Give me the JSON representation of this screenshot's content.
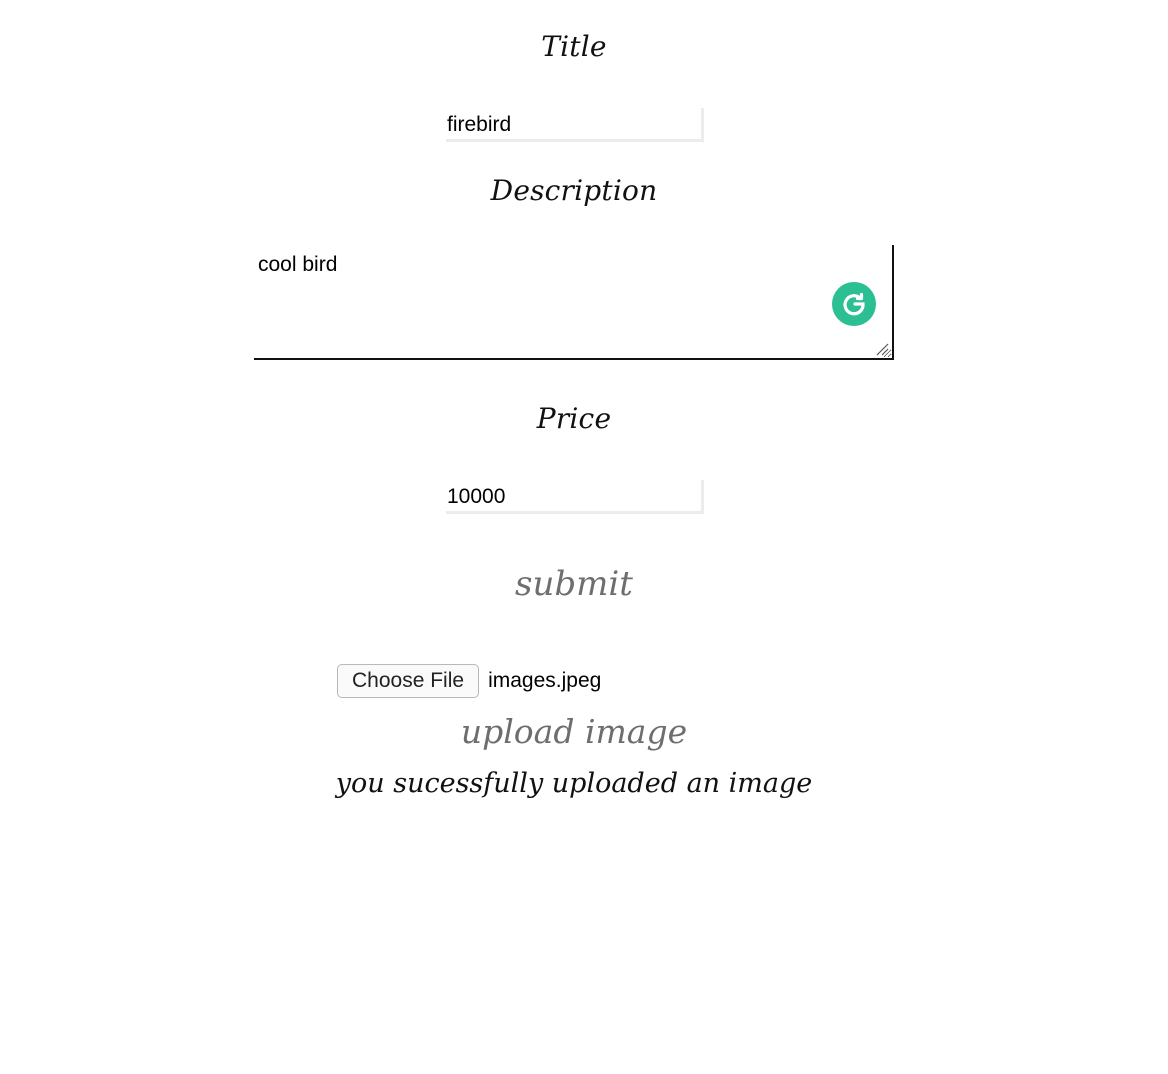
{
  "form": {
    "title_label": "Title",
    "title_value": "firebird",
    "description_label": "Description",
    "description_value": "cool bird",
    "price_label": "Price",
    "price_value": "10000",
    "submit_label": "submit"
  },
  "upload": {
    "choose_file_label": "Choose File",
    "file_name": "images.jpeg",
    "upload_label": "upload image",
    "status_message": "you sucessfully uploaded an image"
  },
  "icons": {
    "grammarly": "grammarly-icon",
    "resize": "resize-grip-icon"
  },
  "colors": {
    "grammarly_green": "#2dbf94",
    "button_text_gray": "#6e6e6e"
  }
}
